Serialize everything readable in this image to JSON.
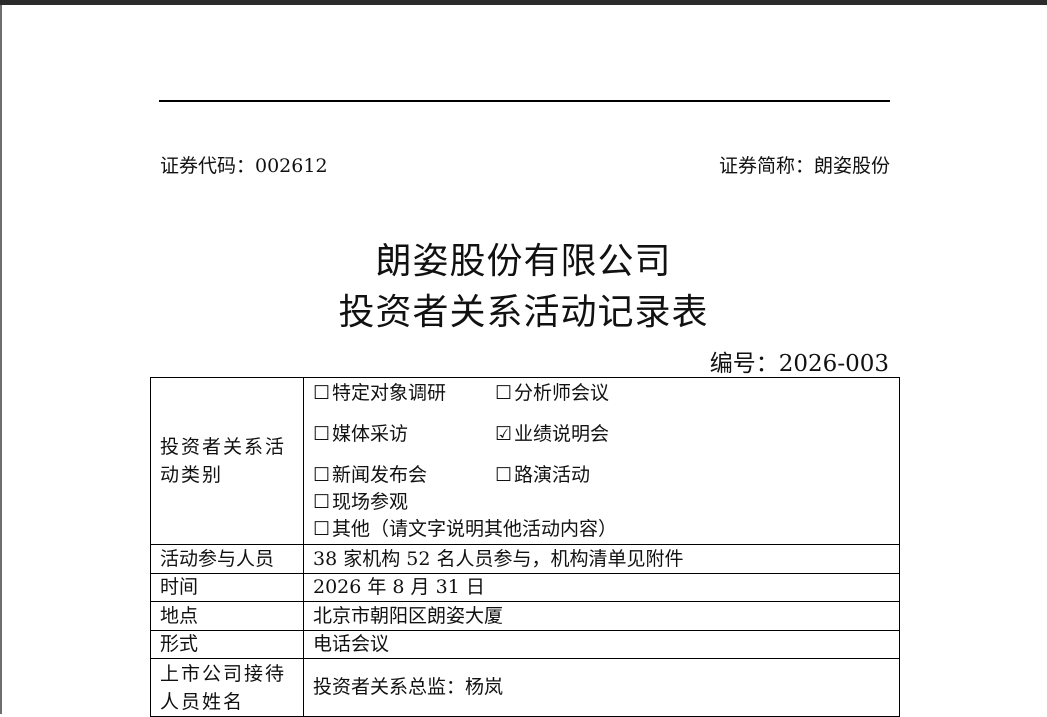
{
  "header": {
    "code_label": "证券代码：002612",
    "abbr_label": "证券简称：朗姿股份"
  },
  "title": {
    "line1": "朗姿股份有限公司",
    "line2": "投资者关系活动记录表"
  },
  "doc_number": "编号：2026-003",
  "activity_type": {
    "label": "投资者关系活动类别",
    "options": [
      {
        "text": "特定对象调研",
        "checked": false,
        "mark": "☐"
      },
      {
        "text": "分析师会议",
        "checked": false,
        "mark": "☐"
      },
      {
        "text": "媒体采访",
        "checked": false,
        "mark": "☐"
      },
      {
        "text": "业绩说明会",
        "checked": true,
        "mark": "☑"
      },
      {
        "text": "新闻发布会",
        "checked": false,
        "mark": "☐"
      },
      {
        "text": "路演活动",
        "checked": false,
        "mark": "☐"
      },
      {
        "text": "现场参观",
        "checked": false,
        "mark": "☐"
      },
      {
        "text": "其他（请文字说明其他活动内容）",
        "checked": false,
        "mark": "☐"
      }
    ]
  },
  "rows": [
    {
      "label": "活动参与人员",
      "value": "38 家机构 52 名人员参与，机构清单见附件"
    },
    {
      "label": "时间",
      "value": "2026 年 8 月 31 日"
    },
    {
      "label": "地点",
      "value": "北京市朝阳区朗姿大厦"
    },
    {
      "label": "形式",
      "value": "电话会议"
    },
    {
      "label": "上市公司接待人员姓名",
      "value": "投资者关系总监：杨岚"
    }
  ]
}
